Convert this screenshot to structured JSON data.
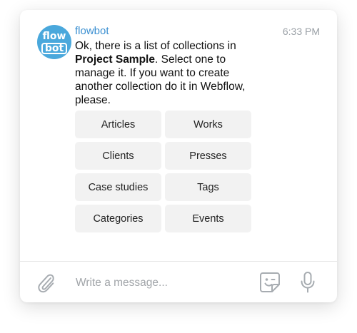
{
  "bot": {
    "avatar_line1": "flow",
    "avatar_line2": "bot",
    "name": "flowbot",
    "time": "6:33 PM"
  },
  "message": {
    "part1": "Ok, there is a list of collections in ",
    "bold": "Project Sample",
    "part2": ". Select one to manage it. If you want to create another collection do it in Webflow, please."
  },
  "keyboard": {
    "buttons": [
      "Articles",
      "Works",
      "Clients",
      "Presses",
      "Case studies",
      "Tags",
      "Categories",
      "Events"
    ]
  },
  "composer": {
    "placeholder": "Write a message...",
    "icons": {
      "attach": "paperclip-icon",
      "sticker": "sticker-icon",
      "mic": "microphone-icon"
    }
  },
  "colors": {
    "avatar_bg": "#4aa8dc",
    "sender_name": "#3a8fd1",
    "button_bg": "#f2f2f2",
    "icon_gray": "#9aa0a6"
  }
}
